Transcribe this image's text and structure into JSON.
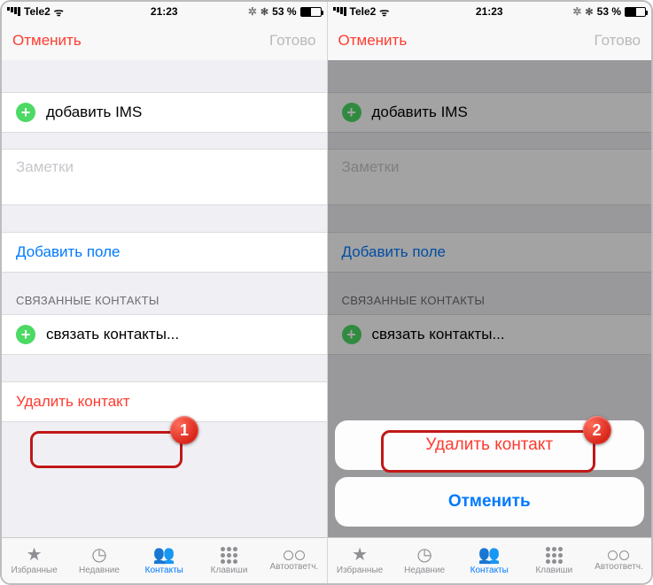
{
  "status": {
    "carrier": "Tele2",
    "time": "21:23",
    "bluetooth": "✻",
    "loading": "✲",
    "battery_pct": "53 %"
  },
  "nav": {
    "cancel": "Отменить",
    "done": "Готово"
  },
  "cells": {
    "add_ims": "добавить IMS",
    "notes_placeholder": "Заметки",
    "add_field": "Добавить поле",
    "linked_header": "СВЯЗАННЫЕ КОНТАКТЫ",
    "link_contacts": "связать контакты...",
    "delete_contact": "Удалить контакт"
  },
  "tabs": {
    "favorites": "Избранные",
    "recents": "Недавние",
    "contacts": "Контакты",
    "keypad": "Клавиши",
    "voicemail": "Автоответч."
  },
  "sheet": {
    "delete": "Удалить контакт",
    "cancel": "Отменить"
  },
  "callout": {
    "left": "1",
    "right": "2"
  }
}
